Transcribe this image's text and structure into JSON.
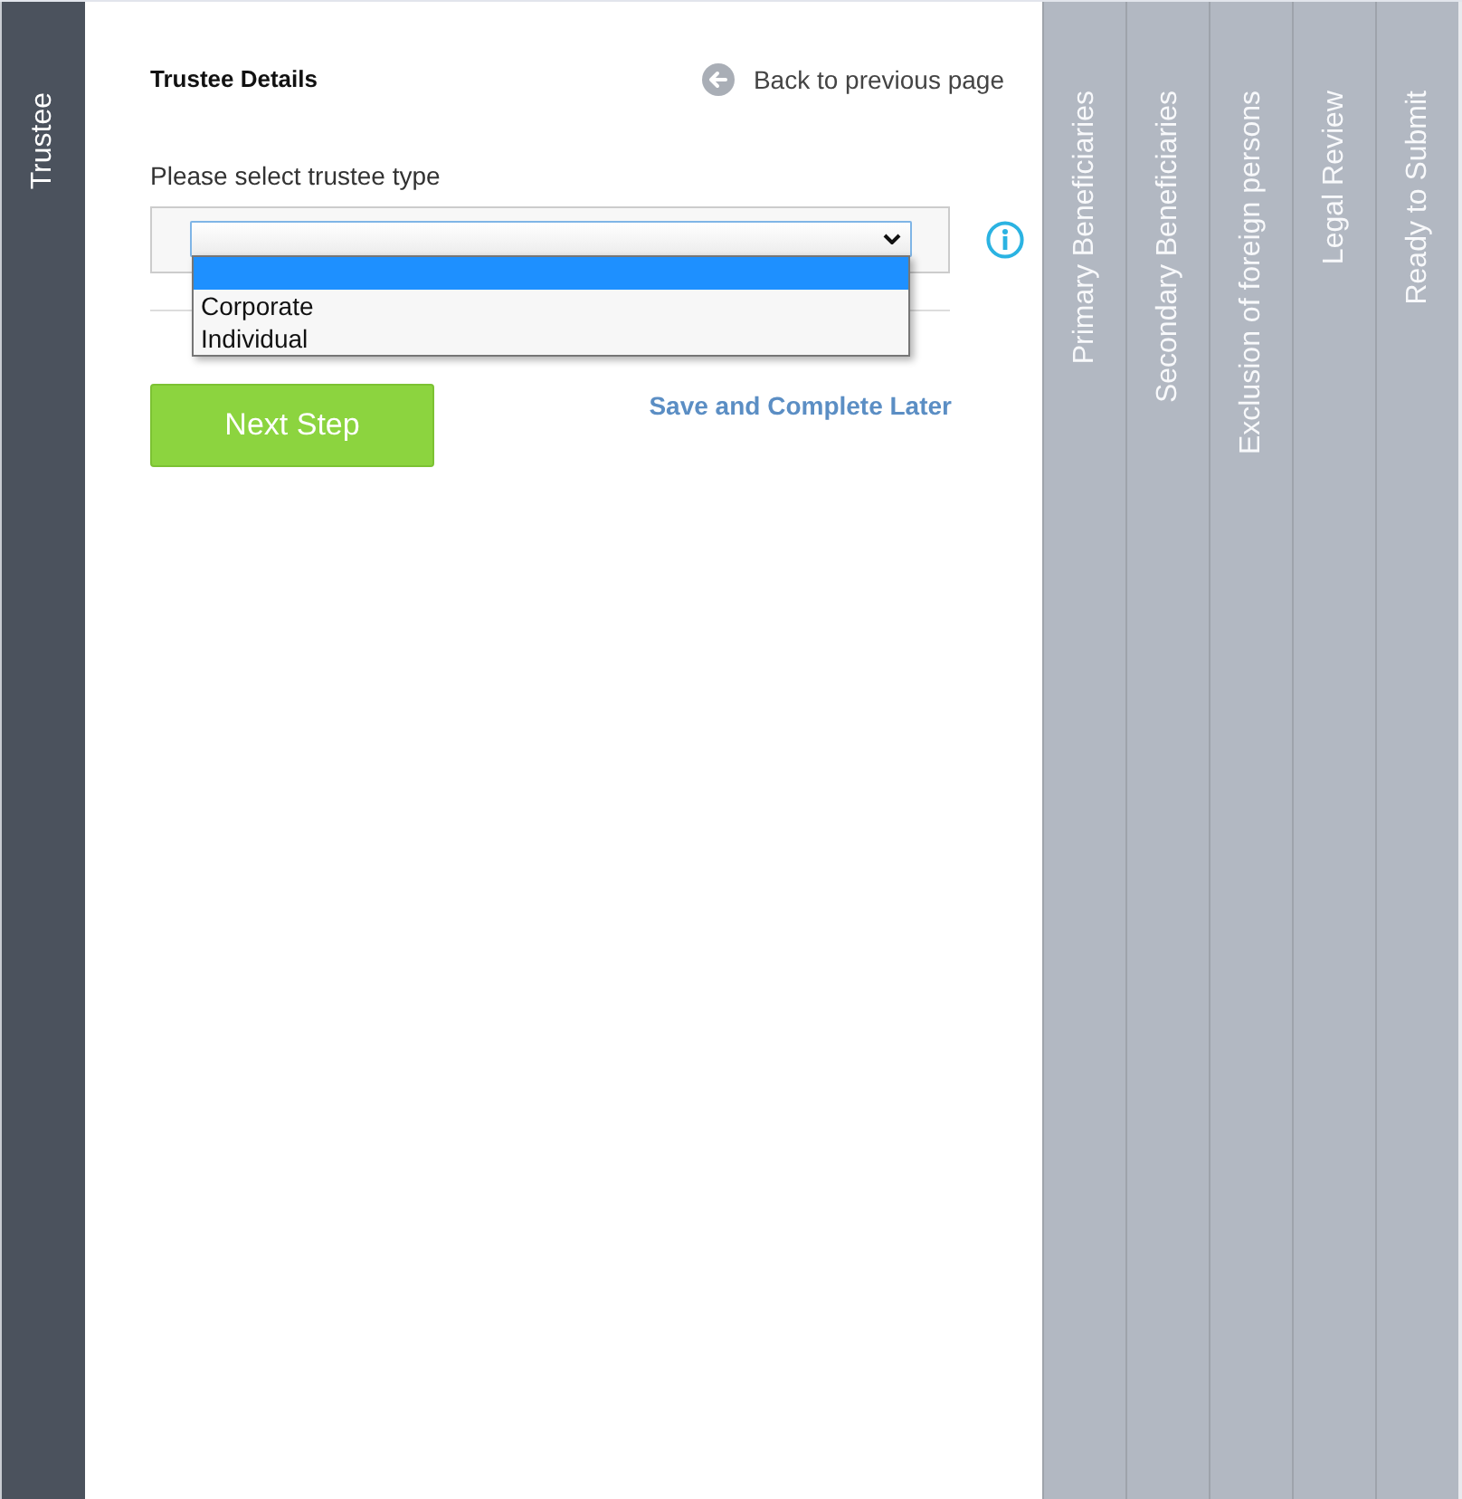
{
  "steps": [
    {
      "label": "Trustee",
      "selected": true
    },
    {
      "label": "Primary Beneficiaries",
      "selected": false
    },
    {
      "label": "Secondary Beneficiaries",
      "selected": false
    },
    {
      "label": "Exclusion of foreign persons",
      "selected": false
    },
    {
      "label": "Legal Review",
      "selected": false
    },
    {
      "label": "Ready to Submit",
      "selected": false
    }
  ],
  "form": {
    "title": "Trustee Details",
    "back_link": "Back to previous page",
    "field_label": "Please select trustee type",
    "select": {
      "expanded": true,
      "options": [
        {
          "selected": true
        },
        {
          "label": "Corporate",
          "selected": false
        },
        {
          "label": "Individual",
          "selected": false
        }
      ]
    },
    "next_button": "Next Step",
    "save_link": "Save and Complete Later"
  }
}
